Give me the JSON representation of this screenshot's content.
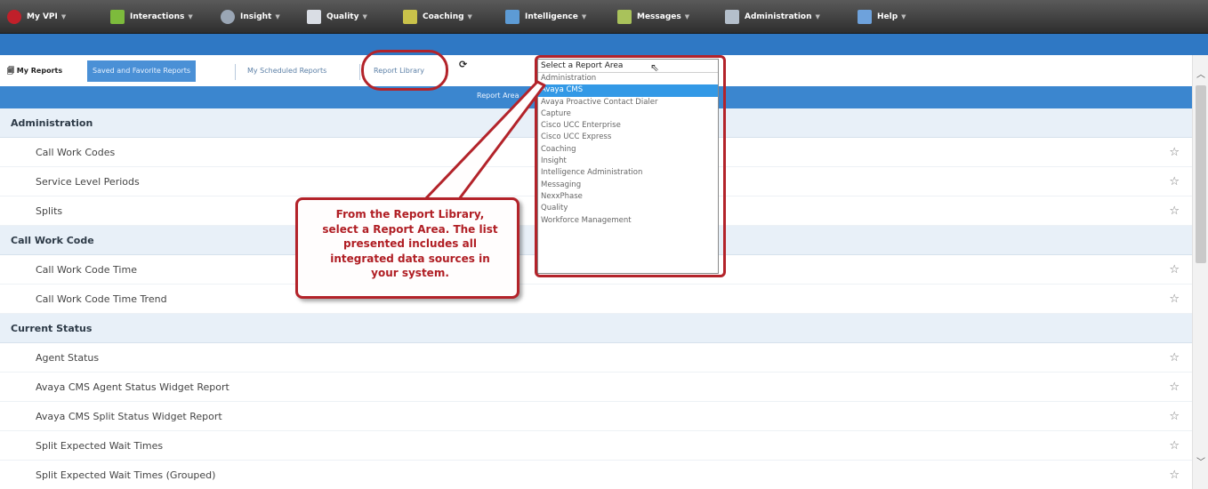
{
  "topnav": {
    "items": [
      {
        "label": "My VPI",
        "icon": "vpi-logo-icon",
        "color": "#c0202a"
      },
      {
        "label": "Interactions",
        "icon": "chart-people-icon",
        "color": "#7dbb3c"
      },
      {
        "label": "Insight",
        "icon": "insight-icon",
        "color": "#9aa6b5"
      },
      {
        "label": "Quality",
        "icon": "checklist-icon",
        "color": "#d9dde4"
      },
      {
        "label": "Coaching",
        "icon": "coaching-board-icon",
        "color": "#c9c24a"
      },
      {
        "label": "Intelligence",
        "icon": "intelligence-chart-icon",
        "color": "#5d9bd5"
      },
      {
        "label": "Messages",
        "icon": "messages-icon",
        "color": "#a9c25b"
      },
      {
        "label": "Administration",
        "icon": "admin-clipboard-icon",
        "color": "#b4bfcb"
      },
      {
        "label": "Help",
        "icon": "help-book-icon",
        "color": "#6ea2dc"
      }
    ]
  },
  "tabs": {
    "my_reports": "My Reports",
    "saved_favorite": "Saved and Favorite Reports",
    "scheduled": "My Scheduled Reports",
    "library": "Report Library"
  },
  "header": {
    "title": "Report Area"
  },
  "groups": [
    {
      "title": "Administration",
      "rows": [
        "Call Work Codes",
        "Service Level Periods",
        "Splits"
      ]
    },
    {
      "title": "Call Work Code",
      "rows": [
        "Call Work Code Time",
        "Call Work Code Time Trend"
      ]
    },
    {
      "title": "Current Status",
      "rows": [
        "Agent Status",
        "Avaya CMS Agent Status Widget Report",
        "Avaya CMS Split Status Widget Report",
        "Split Expected Wait Times",
        "Split Expected Wait Times (Grouped)"
      ]
    }
  ],
  "dropdown": {
    "placeholder": "Select a Report Area",
    "options": [
      "Administration",
      "Avaya CMS",
      "Avaya Proactive Contact Dialer",
      "Capture",
      "Cisco UCC Enterprise",
      "Cisco UCC Express",
      "Coaching",
      "Insight",
      "Intelligence Administration",
      "Messaging",
      "NexxPhase",
      "Quality",
      "Workforce Management"
    ],
    "highlighted": "Avaya CMS"
  },
  "callout": {
    "lines": [
      "From the Report Library,",
      "select a Report Area. The list",
      "presented includes all",
      "integrated data sources in",
      "your system."
    ]
  },
  "colors": {
    "annotation": "#b3232a",
    "accent": "#3b86cf",
    "highlight": "#3399e6"
  }
}
